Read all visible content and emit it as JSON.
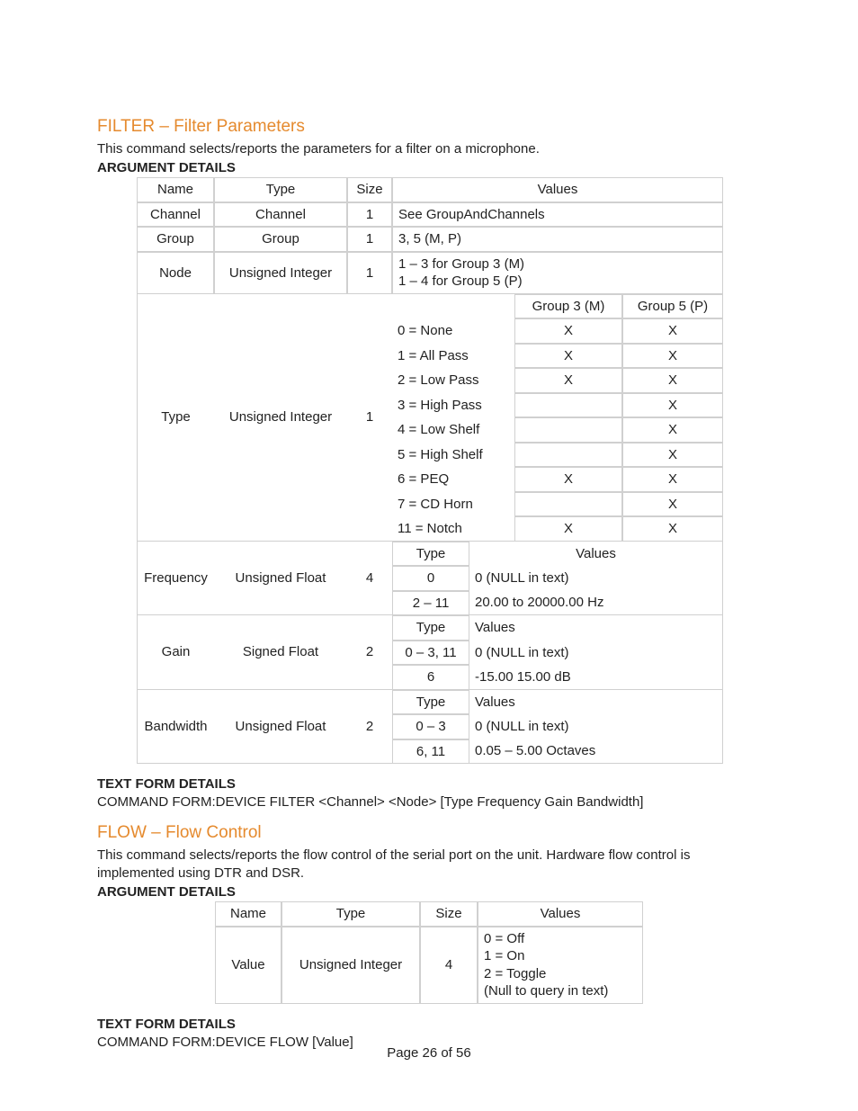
{
  "filter": {
    "heading": "FILTER – Filter Parameters",
    "description": "This command selects/reports the parameters for a filter on a microphone.",
    "argHeading": "ARGUMENT DETAILS",
    "textFormHeading": "TEXT FORM DETAILS",
    "textForm": "COMMAND FORM:DEVICE FILTER <Channel> <Node> [Type Frequency Gain Bandwidth]",
    "col": {
      "name": "Name",
      "type": "Type",
      "size": "Size",
      "values": "Values"
    },
    "rows": {
      "channel": {
        "name": "Channel",
        "type": "Channel",
        "size": "1",
        "values": "See GroupAndChannels"
      },
      "group": {
        "name": "Group",
        "type": "Group",
        "size": "1",
        "values": "3, 5 (M, P)"
      },
      "node": {
        "name": "Node",
        "type": "Unsigned Integer",
        "size": "1",
        "values": "1 – 3 for Group 3 (M)\n1 – 4 for Group 5 (P)"
      },
      "typeRow": {
        "name": "Type",
        "type": "Unsigned Integer",
        "size": "1"
      },
      "freq": {
        "name": "Frequency",
        "type": "Unsigned Float",
        "size": "4"
      },
      "gain": {
        "name": "Gain",
        "type": "Signed Float",
        "size": "2"
      },
      "bw": {
        "name": "Bandwidth",
        "type": "Unsigned Float",
        "size": "2"
      }
    },
    "typeTable": {
      "groupM": "Group 3 (M)",
      "groupP": "Group 5 (P)",
      "rows": [
        {
          "label": "0 = None",
          "m": "X",
          "p": "X"
        },
        {
          "label": "1 = All Pass",
          "m": "X",
          "p": "X"
        },
        {
          "label": "2 = Low Pass",
          "m": "X",
          "p": "X"
        },
        {
          "label": "3 = High Pass",
          "m": "",
          "p": "X"
        },
        {
          "label": "4 = Low Shelf",
          "m": "",
          "p": "X"
        },
        {
          "label": "5 = High Shelf",
          "m": "",
          "p": "X"
        },
        {
          "label": "6 = PEQ",
          "m": "X",
          "p": "X"
        },
        {
          "label": "7 = CD Horn",
          "m": "",
          "p": "X"
        },
        {
          "label": "11 = Notch",
          "m": "X",
          "p": "X"
        }
      ]
    },
    "freqTable": {
      "typeLabel": "Type",
      "valuesLabel": "Values",
      "rows": [
        {
          "type": "0",
          "value": "0 (NULL in text)"
        },
        {
          "type": "2 – 11",
          "value": "20.00 to 20000.00 Hz"
        }
      ]
    },
    "gainTable": {
      "typeLabel": "Type",
      "valuesLabel": "Values",
      "rows": [
        {
          "type": "0 – 3, 11",
          "value": "0 (NULL in text)"
        },
        {
          "type": "6",
          "value": "-15.00 15.00 dB"
        }
      ]
    },
    "bwTable": {
      "typeLabel": "Type",
      "valuesLabel": "Values",
      "rows": [
        {
          "type": "0 – 3",
          "value": "0 (NULL in text)"
        },
        {
          "type": "6, 11",
          "value": "0.05 – 5.00 Octaves"
        }
      ]
    }
  },
  "flow": {
    "heading": "FLOW – Flow Control",
    "description": "This command selects/reports the flow control of the serial port on the unit. Hardware flow control is implemented using DTR and DSR.",
    "argHeading": "ARGUMENT DETAILS",
    "textFormHeading": "TEXT FORM DETAILS",
    "textForm": "COMMAND FORM:DEVICE FLOW [Value]",
    "col": {
      "name": "Name",
      "type": "Type",
      "size": "Size",
      "values": "Values"
    },
    "row": {
      "name": "Value",
      "type": "Unsigned Integer",
      "size": "4",
      "values": "0 = Off\n1 = On\n2 = Toggle\n(Null to query in text)"
    }
  },
  "footer": "Page 26 of 56"
}
